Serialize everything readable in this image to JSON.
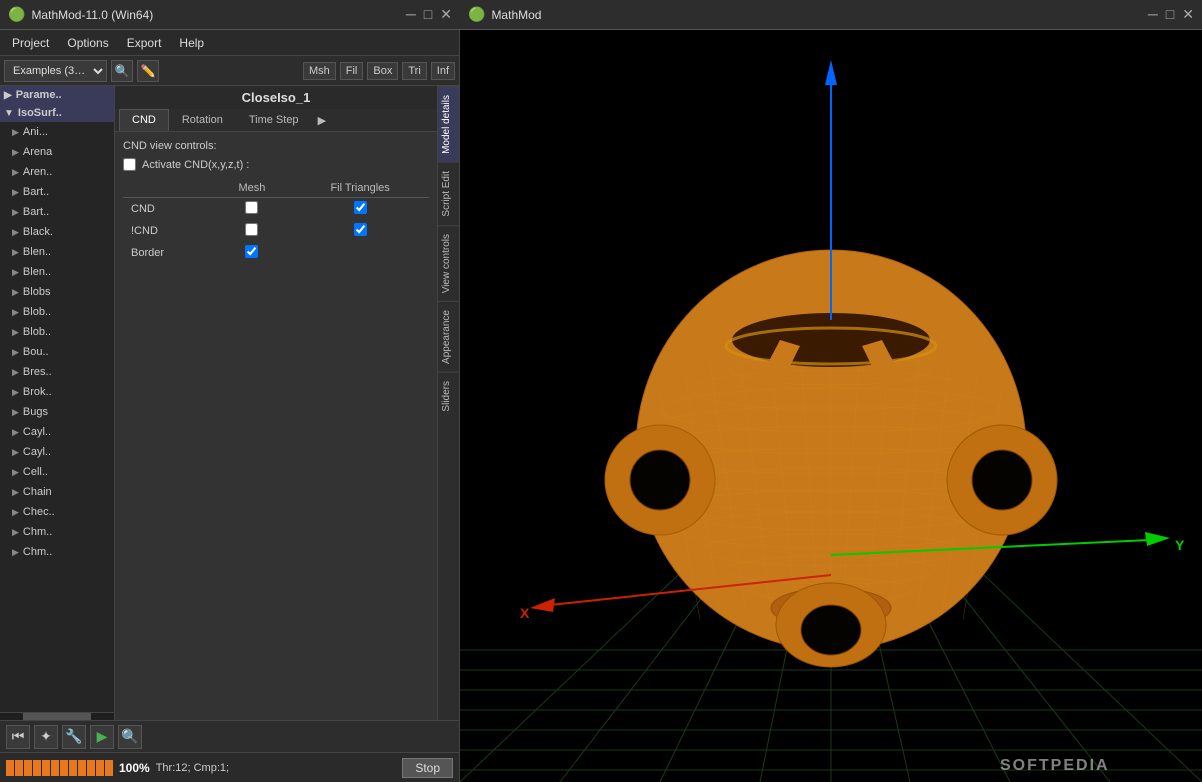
{
  "app": {
    "title_left": "MathMod-11.0 (Win64)",
    "title_right": "MathMod",
    "icon": "🟢"
  },
  "menu": {
    "items": [
      "Project",
      "Options",
      "Export",
      "Help"
    ]
  },
  "toolbar": {
    "dropdown_label": "Examples (3…",
    "tags": [
      "Msh",
      "Fil",
      "Box",
      "Tri",
      "Inf"
    ]
  },
  "model": {
    "title": "CloseIso_1"
  },
  "tabs": {
    "main": [
      "CND",
      "Rotation",
      "Time Step"
    ],
    "arrow": "▶"
  },
  "cnd": {
    "view_controls_label": "CND view controls:",
    "activate_label": "Activate CND(x,y,z,t) :",
    "activate_checked": false,
    "columns": [
      "Mesh",
      "Fil Triangles"
    ],
    "rows": [
      {
        "label": "CND",
        "mesh_checked": true,
        "fil_checked": true
      },
      {
        "label": "!CND",
        "mesh_checked": true,
        "fil_checked": true
      },
      {
        "label": "Border",
        "mesh_checked": false,
        "fil_checked": false
      }
    ]
  },
  "side_tabs": [
    "Model details",
    "Script Edit",
    "View controls",
    "Appearance",
    "Sliders"
  ],
  "list": {
    "groups": [
      {
        "label": "Parame..",
        "expanded": true,
        "items": []
      },
      {
        "label": "IsoSurf..",
        "expanded": true,
        "items": [
          "Ani...",
          "Arena",
          "Aren..",
          "Bart..",
          "Bart..",
          "Black.",
          "Blen..",
          "Blen..",
          "Blobs",
          "Blob..",
          "Blob..",
          "Bou..",
          "Bres..",
          "Brok..",
          "Bugs",
          "Cayl..",
          "Cayl..",
          "Cell..",
          "Chain",
          "Chec..",
          "Chm..",
          "Chm.."
        ]
      }
    ]
  },
  "bottom_toolbar": {
    "buttons": [
      "⏮",
      "✦",
      "🔧",
      "▶",
      "🔍"
    ]
  },
  "status_bar": {
    "progress_percent": "100%",
    "info": "Thr:12; Cmp:1;",
    "stop_label": "Stop"
  },
  "colors": {
    "accent": "#e87820",
    "bg_dark": "#1a1a1a",
    "bg_panel": "#2a2a2a",
    "bg_tab": "#3a3a3a",
    "highlight": "#4a4a6a"
  }
}
